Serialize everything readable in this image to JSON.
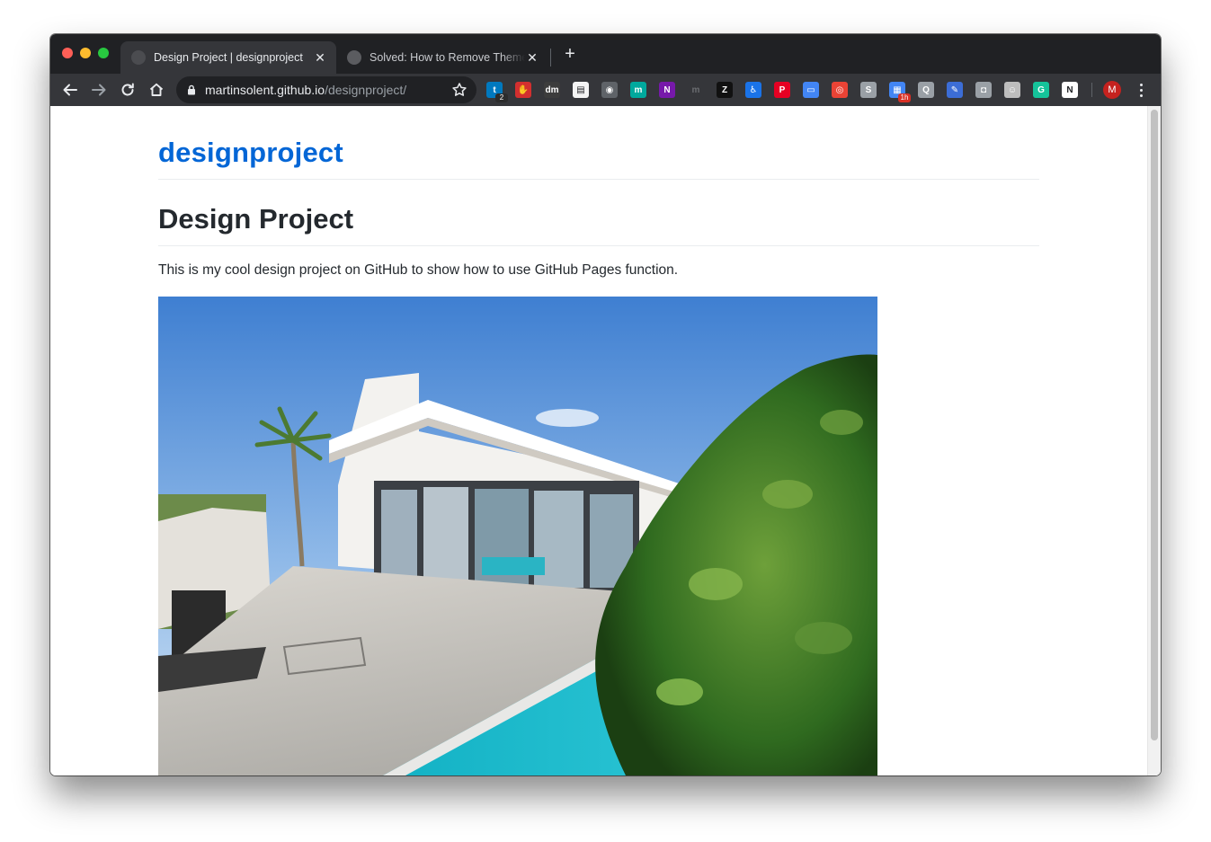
{
  "browser": {
    "tabs": [
      {
        "title": "Design Project | designproject",
        "active": true
      },
      {
        "title": "Solved: How to Remove Theme f",
        "active": false
      }
    ],
    "close_glyph": "✕",
    "new_tab_glyph": "+",
    "url": {
      "host": "martinsolent.github.io",
      "path": "/designproject/"
    },
    "extensions": [
      {
        "name": "trello-icon",
        "color": "#0079bf",
        "glyph": "t",
        "badge": "2",
        "badge_color": "#2c2c2c"
      },
      {
        "name": "adblock-icon",
        "color": "#d32f2f",
        "glyph": "✋"
      },
      {
        "name": "dm-icon",
        "color": "#3c3c3c",
        "glyph": "dm"
      },
      {
        "name": "sheets-icon",
        "color": "#f4f4f4",
        "glyph": "▤"
      },
      {
        "name": "bulb-icon",
        "color": "#5f6368",
        "glyph": "◉"
      },
      {
        "name": "m-circle-icon",
        "color": "#00a99d",
        "glyph": "m"
      },
      {
        "name": "onenote-icon",
        "color": "#7719aa",
        "glyph": "N"
      },
      {
        "name": "m-italic-icon",
        "color": "#35363a",
        "glyph": "m"
      },
      {
        "name": "zebra-icon",
        "color": "#111111",
        "glyph": "Z"
      },
      {
        "name": "accessibility-icon",
        "color": "#1a73e8",
        "glyph": "♿"
      },
      {
        "name": "pinterest-icon",
        "color": "#e60023",
        "glyph": "P"
      },
      {
        "name": "docs-icon",
        "color": "#4285f4",
        "glyph": "▭"
      },
      {
        "name": "chrome-ring-icon",
        "color": "#ea4335",
        "glyph": "◎"
      },
      {
        "name": "skype-icon",
        "color": "#9aa0a6",
        "glyph": "S"
      },
      {
        "name": "calendar-icon",
        "color": "#4285f4",
        "glyph": "▦",
        "badge": "1h",
        "badge_color": "#d93025"
      },
      {
        "name": "keep-icon",
        "color": "#9aa0a6",
        "glyph": "Q"
      },
      {
        "name": "notes-icon",
        "color": "#3c6dd6",
        "glyph": "✎"
      },
      {
        "name": "camera-icon",
        "color": "#9aa0a6",
        "glyph": "◘"
      },
      {
        "name": "smiley-icon",
        "color": "#bdbdbd",
        "glyph": "☺"
      },
      {
        "name": "grammarly-icon",
        "color": "#15c39a",
        "glyph": "G"
      },
      {
        "name": "notion-icon",
        "color": "#ffffff",
        "glyph": "N"
      }
    ],
    "profile_initial": "M"
  },
  "page": {
    "site_title": "designproject",
    "heading": "Design Project",
    "intro": "This is my cool design project on GitHub to show how to use GitHub Pages function."
  },
  "colors": {
    "link_blue": "#0366d6",
    "text": "#24292e",
    "rule": "#eaecef",
    "tab_strip": "#202124",
    "toolbar": "#35363a"
  }
}
